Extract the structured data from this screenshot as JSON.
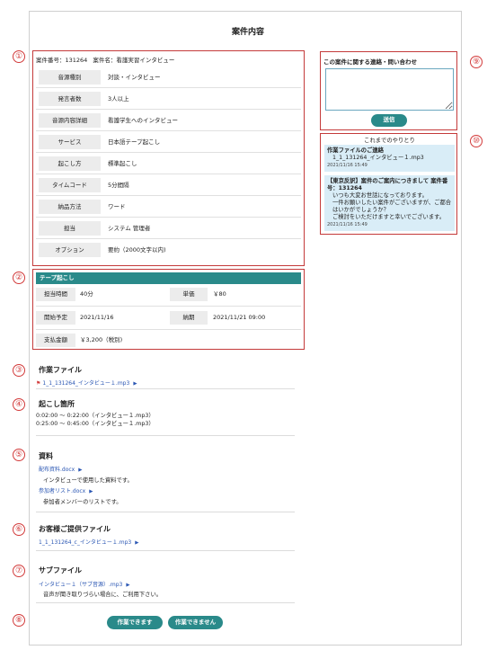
{
  "page": {
    "title": "案件内容"
  },
  "markers": [
    "①",
    "②",
    "③",
    "④",
    "⑤",
    "⑥",
    "⑦",
    "⑧",
    "⑨",
    "⑩"
  ],
  "case": {
    "number_label": "案件番号：131264",
    "name_label": "案件名：看護実習インタビュー",
    "specs": [
      {
        "label": "音源種別",
        "value": "対談・インタビュー"
      },
      {
        "label": "発言者数",
        "value": "3人以上"
      },
      {
        "label": "音源内容詳細",
        "value": "看護学生へのインタビュー"
      },
      {
        "label": "サービス",
        "value": "日本語テープ起こし"
      },
      {
        "label": "起こし方",
        "value": "標準起こし"
      },
      {
        "label": "タイムコード",
        "value": "5分間隔"
      },
      {
        "label": "納品方法",
        "value": "ワード"
      },
      {
        "label": "担当",
        "value": "システム 管理者"
      },
      {
        "label": "オプション",
        "value": "要約（2000文字以内)"
      }
    ]
  },
  "tape": {
    "header": "テープ起こし",
    "duration_label": "担当時間",
    "duration_value": "40分",
    "unit_label": "単価",
    "unit_value": "￥80",
    "start_label": "開始予定",
    "start_value": "2021/11/16",
    "due_label": "納期",
    "due_value": "2021/11/21 09:00",
    "pay_label": "支払金額",
    "pay_value": "￥3,200（税別)"
  },
  "work_file": {
    "title": "作業ファイル",
    "file": "1_1_131264_インタビュー１.mp3"
  },
  "transcribe": {
    "title": "起こし箇所",
    "ranges": [
      "0:02:00 〜 0:22:00（インタビュー１.mp3）",
      "0:25:00 〜 0:45:00（インタビュー１.mp3）"
    ]
  },
  "materials": {
    "title": "資料",
    "items": [
      {
        "file": "配布資料.docx",
        "note": "インタビューで使用した資料です。"
      },
      {
        "file": "参加者リスト.docx",
        "note": "参加者メンバーのリストです。"
      }
    ]
  },
  "customer_file": {
    "title": "お客様ご提供ファイル",
    "file": "1_1_131264_c_インタビュー１.mp3"
  },
  "sub_file": {
    "title": "サブファイル",
    "file": "インタビュー１（サブ音源）.mp3",
    "note": "音声が聞き取りづらい場合に、ご利用下さい。"
  },
  "actions": {
    "accept": "作業できます",
    "decline": "作業できません"
  },
  "contact": {
    "title": "この案件に関する連絡・問い合わせ",
    "send": "送信"
  },
  "history": {
    "title": "これまでのやりとり",
    "messages": [
      {
        "title": "作業ファイルのご連絡",
        "body": [
          "1_1_131264_インタビュー１.mp3"
        ],
        "time": "2021/11/16 15:49"
      },
      {
        "title": "【東京反訳】案件のご案内につきまして 案件番号：131264",
        "body": [
          "いつも大変お世話になっております。",
          "一件お願いしたい案件がございますが、ご都合はいかがでしょうか？",
          "ご検討をいただけますと幸いでございます。"
        ],
        "time": "2021/11/16 15:49"
      }
    ]
  },
  "colors": {
    "accent": "#2a8a8a",
    "marker": "#d23a3a",
    "link": "#2a56b3",
    "message_bg": "#d9edf7"
  }
}
